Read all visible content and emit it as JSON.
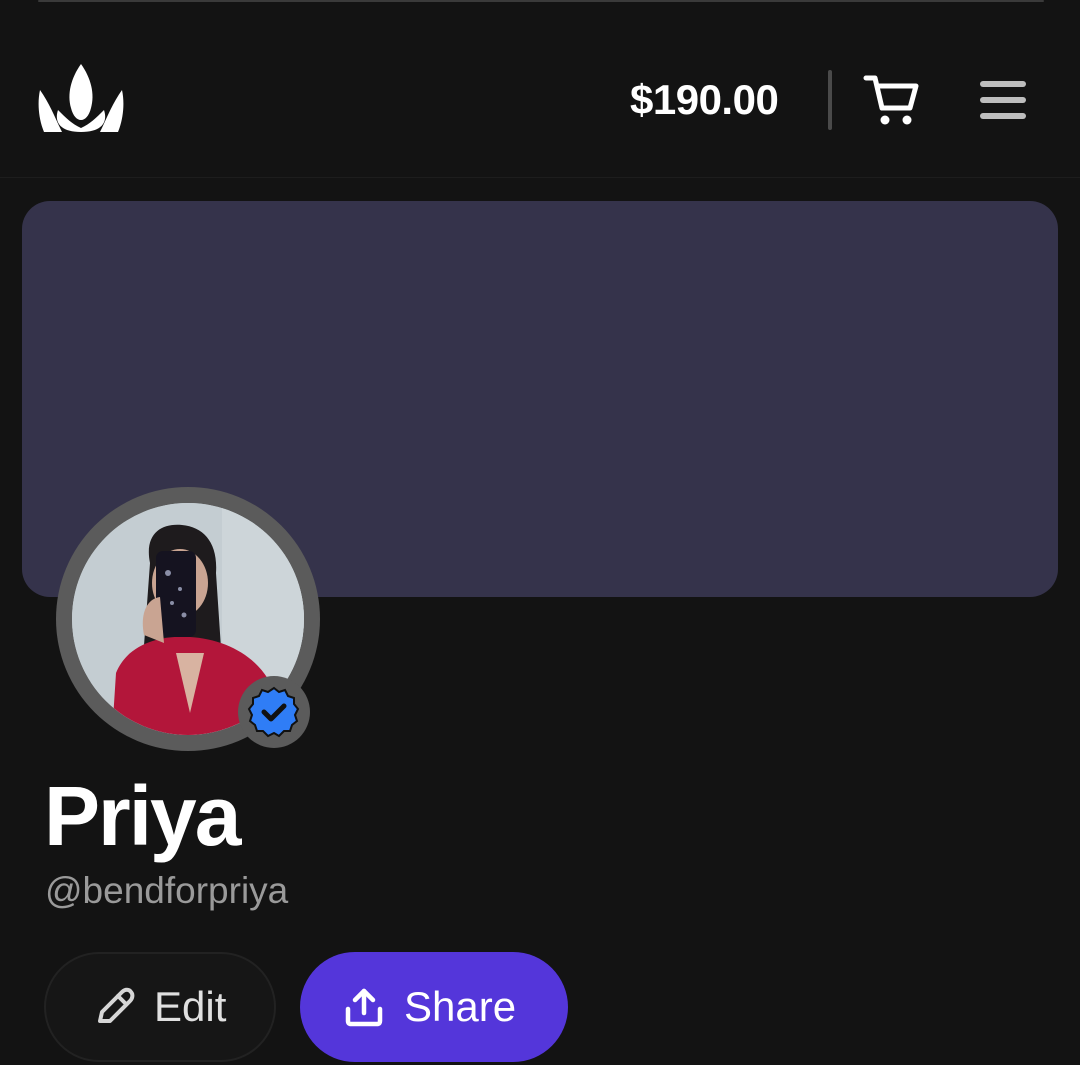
{
  "header": {
    "balance": "$190.00",
    "logo_icon": "crown-logo",
    "cart_icon": "cart-icon",
    "menu_icon": "hamburger-menu-icon"
  },
  "banner": {
    "color": "#35334b"
  },
  "profile": {
    "name": "Priya",
    "handle": "@bendforpriya",
    "verified": true,
    "verified_color": "#2f7df6"
  },
  "actions": {
    "edit_label": "Edit",
    "edit_icon": "pencil-icon",
    "share_label": "Share",
    "share_icon": "share-upload-icon",
    "share_color": "#5436da"
  }
}
